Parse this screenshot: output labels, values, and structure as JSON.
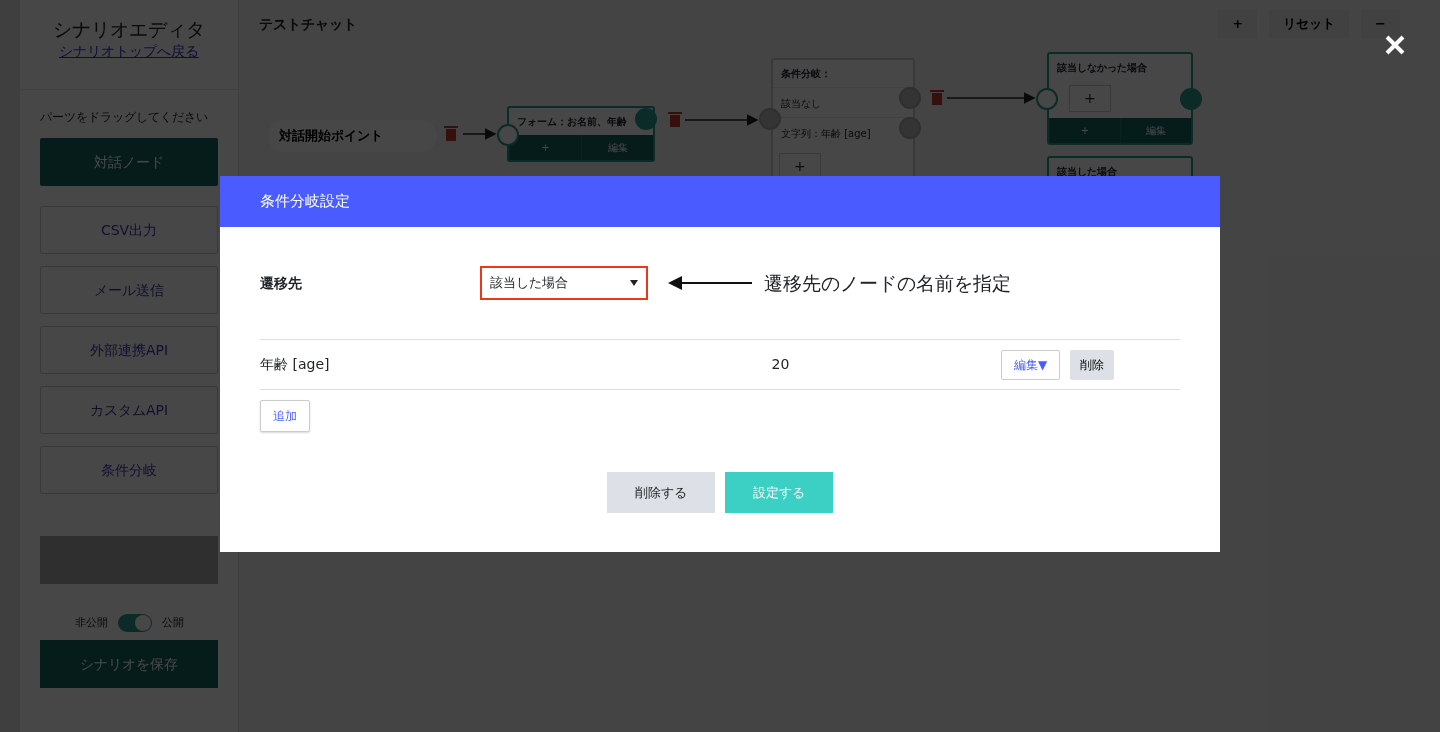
{
  "sidebar": {
    "title": "シナリオエディタ",
    "back_link": "シナリオトップへ戻る",
    "hint": "パーツをドラッグしてください",
    "parts": [
      {
        "label": "対話ノード",
        "kind": "primary"
      },
      {
        "label": "CSV出力",
        "kind": "outline"
      },
      {
        "label": "メール送信",
        "kind": "outline"
      },
      {
        "label": "外部連携API",
        "kind": "outline"
      },
      {
        "label": "カスタムAPI",
        "kind": "outline"
      },
      {
        "label": "条件分岐",
        "kind": "outline"
      }
    ],
    "run_button": {
      "disabled": true
    },
    "publish_toggle": {
      "off_label": "非公開",
      "on_label": "公開",
      "on": true
    },
    "save_button": "シナリオを保存"
  },
  "canvas": {
    "title": "テストチャット",
    "toolbar": [
      "+",
      "リセット",
      "−"
    ],
    "start_node": "対話開始ポイント",
    "form_node": {
      "title": "フォーム：お名前、年齢",
      "buttons": [
        "+",
        "編集"
      ]
    },
    "branch_node": {
      "title": "条件分岐：",
      "rows": [
        "該当なし",
        "文字列：年齢 [age]"
      ],
      "add": "+"
    },
    "target_nodes": [
      {
        "title": "該当しなかった場合",
        "add": "+",
        "buttons": [
          "+",
          "編集"
        ]
      },
      {
        "title": "該当した場合"
      }
    ]
  },
  "modal": {
    "title": "条件分岐設定",
    "field_label": "遷移先",
    "select_value": "該当した場合",
    "annotation": "遷移先のノードの名前を指定",
    "conditions": [
      {
        "name": "年齢 [age]",
        "value": "20",
        "edit": "編集▼",
        "delete": "削除"
      }
    ],
    "add_button": "追加",
    "footer_buttons": [
      {
        "label": "削除する",
        "kind": "secondary"
      },
      {
        "label": "設定する",
        "kind": "primary"
      }
    ]
  }
}
